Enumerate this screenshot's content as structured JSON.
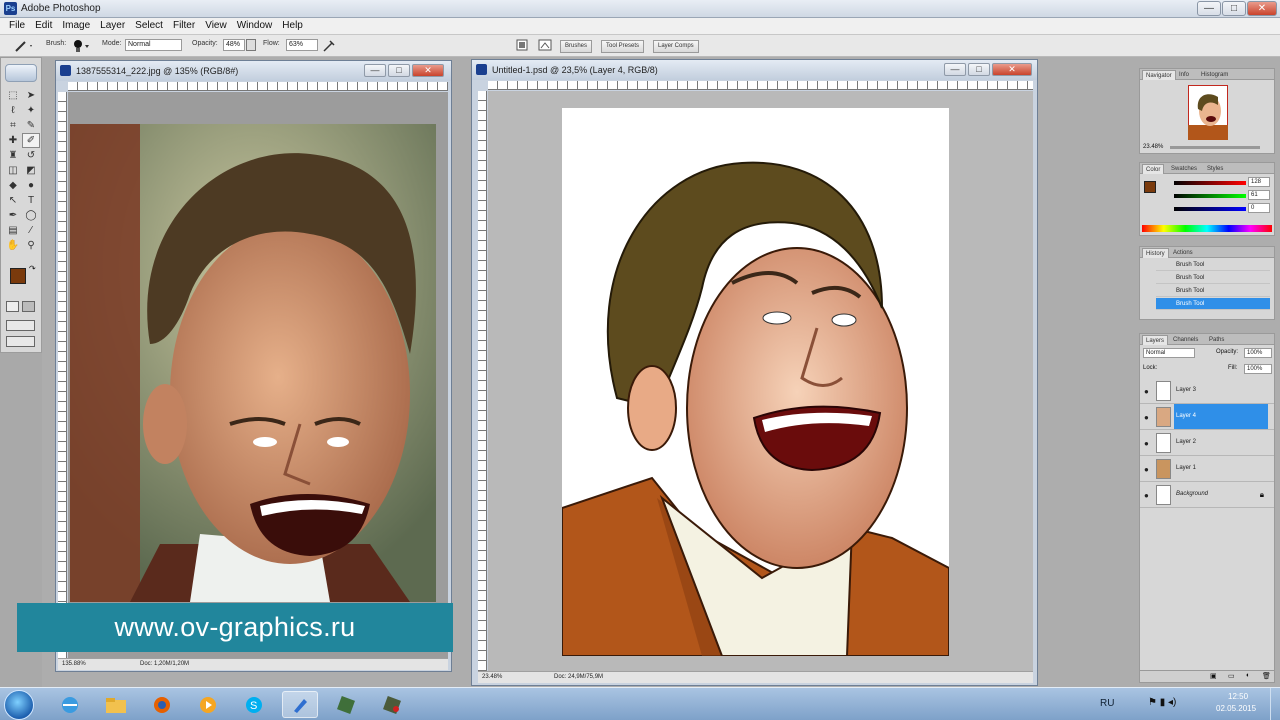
{
  "window": {
    "title": "Adobe Photoshop",
    "min": "—",
    "max": "□",
    "close": "✕"
  },
  "menu": [
    "File",
    "Edit",
    "Image",
    "Layer",
    "Select",
    "Filter",
    "View",
    "Window",
    "Help"
  ],
  "options": {
    "brush_label": "Brush:",
    "mode_label": "Mode:",
    "mode_value": "Normal",
    "opacity_label": "Opacity:",
    "opacity_value": "48%",
    "flow_label": "Flow:",
    "flow_value": "63%"
  },
  "well_tabs": [
    "Brushes",
    "Tool Presets",
    "Layer Comps"
  ],
  "doc1": {
    "title": "1387555314_222.jpg @ 135% (RGB/8#)",
    "zoom": "135.88%",
    "doc": "Doc: 1,20M/1,20M"
  },
  "doc2": {
    "title": "Untitled-1.psd @ 23,5% (Layer 4, RGB/8)",
    "zoom": "23.48%",
    "doc": "Doc: 24,9M/75,9M"
  },
  "banner": "www.ov-graphics.ru",
  "navigator": {
    "tabs": [
      "Navigator",
      "Info",
      "Histogram"
    ],
    "zoom": "23.48%"
  },
  "color": {
    "tabs": [
      "Color",
      "Swatches",
      "Styles"
    ],
    "r": "128",
    "g": "61",
    "b": "0",
    "fg": "#7a3a0c"
  },
  "history": {
    "tabs": [
      "History",
      "Actions"
    ],
    "items": [
      "Brush Tool",
      "Brush Tool",
      "Brush Tool",
      "Brush Tool"
    ]
  },
  "layers": {
    "tabs": [
      "Layers",
      "Channels",
      "Paths"
    ],
    "blend": "Normal",
    "opacity_label": "Opacity:",
    "opacity_value": "100%",
    "lock_label": "Lock:",
    "fill_label": "Fill:",
    "fill_value": "100%",
    "items": [
      "Layer 3",
      "Layer 4",
      "Layer 2",
      "Layer 1",
      "Background"
    ]
  },
  "tray": {
    "lang": "RU",
    "time": "12:50",
    "date": "02.05.2015"
  },
  "colors": {
    "accent": "#2f8fe8",
    "banner": "#21869c",
    "jacket": "#b2561a"
  }
}
